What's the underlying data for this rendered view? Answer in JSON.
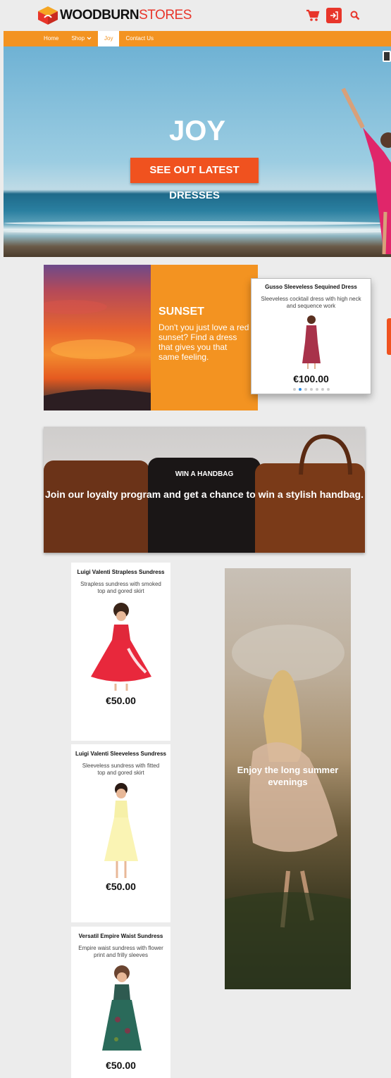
{
  "brand": {
    "name_bold": "WOODBURN",
    "name_light": "STORES"
  },
  "header": {
    "icons": [
      "cart-icon",
      "login-icon",
      "search-icon"
    ]
  },
  "nav": {
    "items": [
      {
        "label": "Home"
      },
      {
        "label": "Shop"
      },
      {
        "label": "Joy"
      },
      {
        "label": "Contact Us"
      }
    ],
    "active": "Joy"
  },
  "hero": {
    "title": "JOY",
    "button_label": "SEE OUT LATEST DRESSES"
  },
  "sunset": {
    "title": "SUNSET",
    "text": "Don't you just love a red sunset?  Find a dress that gives you that same feeling."
  },
  "carousel": {
    "product": {
      "title": "Gusso Sleeveless Sequined Dress",
      "description": "Sleeveless cocktail dress with high neck and sequence work",
      "price": "€100.00"
    },
    "dots_total": 7,
    "active_dot": 1
  },
  "handbag": {
    "subtitle": "WIN A HANDBAG",
    "title": "Join our loyalty program and get a chance to win a stylish handbag."
  },
  "products": [
    {
      "title": "Luigi Valenti Strapless Sundress",
      "description": "Strapless sundress with smoked top and gored skirt",
      "price": "€50.00"
    },
    {
      "title": "Luigi Valenti Sleeveless Sundress",
      "description": "Sleeveless sundress with fitted top and gored skirt",
      "price": "€50.00"
    },
    {
      "title": "Versatil Empire Waist Sundress",
      "description": "Empire waist sundress with flower print and frilly sleeves",
      "price": "€50.00"
    }
  ],
  "summer": {
    "text": "Enjoy the long summer evenings"
  },
  "colors": {
    "accent_orange": "#f39321",
    "brand_red": "#e8352a",
    "cta_orange": "#f0521f",
    "dot_active": "#2f8de4"
  }
}
